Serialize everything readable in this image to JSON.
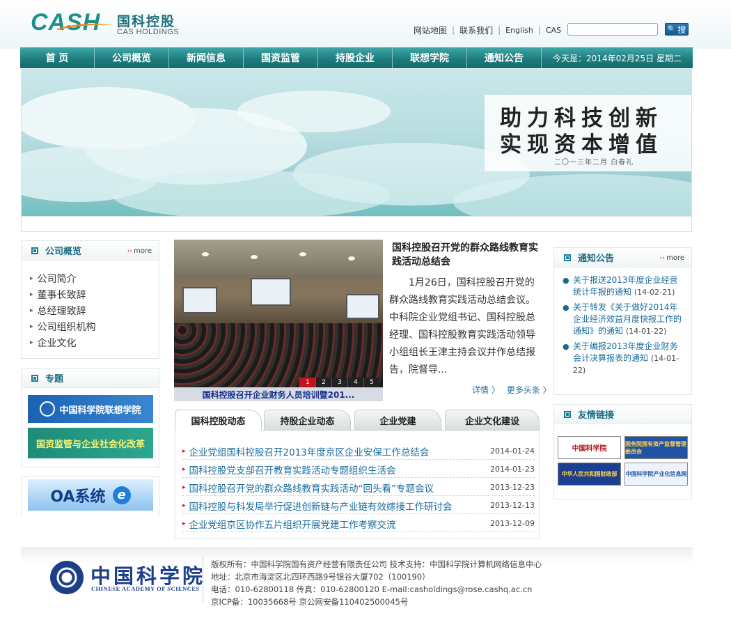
{
  "header": {
    "logo_mark": "CASH",
    "logo_cn": "国科控股",
    "logo_en": "CAS HOLDINGS",
    "links": [
      "网站地图",
      "联系我们",
      "English",
      "CAS"
    ],
    "search_placeholder": "",
    "search_button": "搜"
  },
  "nav": {
    "items": [
      "首 页",
      "公司概览",
      "新闻信息",
      "国资监管",
      "持股企业",
      "联想学院",
      "通知公告"
    ],
    "date": "今天是：2014年02月25日 星期二"
  },
  "banner": {
    "line1": "助力科技创新",
    "line2": "实现资本增值",
    "signature": "二〇一三年二月 白春礼"
  },
  "overview": {
    "title": "公司概览",
    "more": "more",
    "items": [
      "公司简介",
      "董事长致辞",
      "总经理致辞",
      "公司组织机构",
      "企业文化"
    ]
  },
  "topics": {
    "title": "专题",
    "promo1": "中国科学院联想学院",
    "promo2": "国资监管与企业社会化改革"
  },
  "oa": {
    "label": "OA系统",
    "logo": "e"
  },
  "photo": {
    "pages": [
      "1",
      "2",
      "3",
      "4",
      "5"
    ],
    "caption": "国科控股召开企业财务人员培训暨201..."
  },
  "headline": {
    "title": "国科控股召开党的群众路线教育实践活动总结会",
    "text": "1月26日，国科控股召开党的群众路线教育实践活动总结会议。中科院企业党组书记、国科控股总经理、国科控股教育实践活动领导小组组长王津主持会议并作总结报告，院督导...",
    "detail": "详情",
    "more": "更多头条"
  },
  "tabs": [
    "国科控股动态",
    "持股企业动态",
    "企业党建",
    "企业文化建设"
  ],
  "news": [
    {
      "title": "企业党组国科控股召开2013年度京区企业安保工作总结会",
      "date": "2014-01-24"
    },
    {
      "title": "国科控股党支部召开教育实践活动专题组织生活会",
      "date": "2014-01-23"
    },
    {
      "title": "国科控股召开党的群众路线教育实践活动“回头看”专题会议",
      "date": "2013-12-23"
    },
    {
      "title": "国科控股与科发局举行促进创新链与产业链有效嫁接工作研讨会",
      "date": "2013-12-13"
    },
    {
      "title": "企业党组京区协作五片组织开展党建工作考察交流",
      "date": "2013-12-09"
    }
  ],
  "notices": {
    "title": "通知公告",
    "more": "more",
    "items": [
      {
        "title": "关于报送2013年度企业经营统计年报的通知",
        "date": "(14-02-21)"
      },
      {
        "title": "关于转发《关于做好2014年企业经济效益月度快报工作的通知》的通知",
        "date": "(14-01-22)"
      },
      {
        "title": "关于编报2013年度企业财务会计决算报表的通知",
        "date": "(14-01-22)"
      }
    ]
  },
  "friend_links": {
    "title": "友情链接",
    "tiles": [
      "中国科学院",
      "国务院国有资产监督管理委员会",
      "中华人民共和国财政部",
      "中国科学院产业化信息网"
    ]
  },
  "footer": {
    "org_cn": "中国科学院",
    "org_en": "CHINESE ACADEMY OF SCIENCES",
    "line1": "版权所有：中国科学院国有资产经营有限责任公司 技术支持：中国科学院计算机网络信息中心",
    "line2": "地址：北京市海淀区北四环西路9号银谷大厦702（100190）",
    "line3": "电话：010-62800118 传真：010-62800120 E-mail:casholdings@rose.cashq.ac.cn",
    "line4": "京ICP备：10035668号 京公网安备110402500045号"
  },
  "colors": {
    "teal": "#1f7c7e",
    "link": "#1a6d9e",
    "accent": "#c0141a"
  }
}
